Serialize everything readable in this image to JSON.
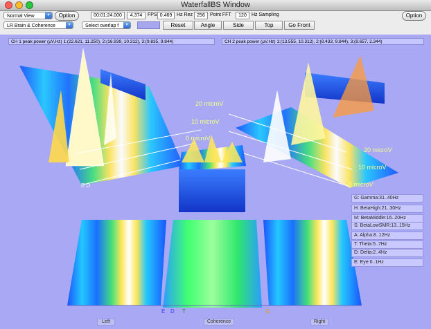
{
  "window": {
    "title": "WaterfallBS Window"
  },
  "toolbar": {
    "view_select": "Normal View",
    "option_left": "Option",
    "time": "00:01:24.000",
    "fps_value": "4.374",
    "fps_label": "FPS",
    "hz_rez_value": "0.469",
    "hz_rez_label": "Hz Rez",
    "fft_points_value": "256",
    "fft_label": "Point FFT",
    "sampling_value": "120",
    "sampling_label": "Hz Sampling",
    "option_right": "Option",
    "montage_select": "LR Brain & Coherence",
    "overlap_select": "Select overlap f",
    "reset": "Reset",
    "angle": "Angle",
    "side": "Side",
    "top": "Top",
    "go_front": "Go Front"
  },
  "channels": {
    "ch1_peaks": "CH 1 peak power (µV,Hz) 1:(22.621, 11.250), 2:(16.939, 10.312), 3:(9.835, 9.844)",
    "ch2_peaks": "CH 2 peak power (µV,Hz) 1:(13.555, 10.312), 2:(8.433, 9.844), 3:(8.657, 2.344)"
  },
  "scale_labels": {
    "left": [
      "20 microV",
      "10 microV",
      "0 microV"
    ],
    "right": [
      "20 microV",
      "10 microV",
      "0 microV"
    ]
  },
  "legend": [
    "G: Gamma:31..40Hz",
    "H: BetaHigh:21..30Hz",
    "M: BetaMiddle:16..20Hz",
    "S: BetaLowSMR:13..15Hz",
    "A: Alpha:8..12Hz",
    "T: Theta:5..7Hz",
    "D: Delta:2..4Hz",
    "E: Eye:0..1Hz"
  ],
  "axis_letters": {
    "e": "E",
    "d": "D",
    "t": "T",
    "g": "G",
    "left_axis": "E D"
  },
  "bottom_labels": {
    "left": "Left",
    "center": "Coherence",
    "right": "Right"
  },
  "colors": {
    "viewport_bg": "#a8a8f4",
    "accent": "#2f6bd1"
  }
}
